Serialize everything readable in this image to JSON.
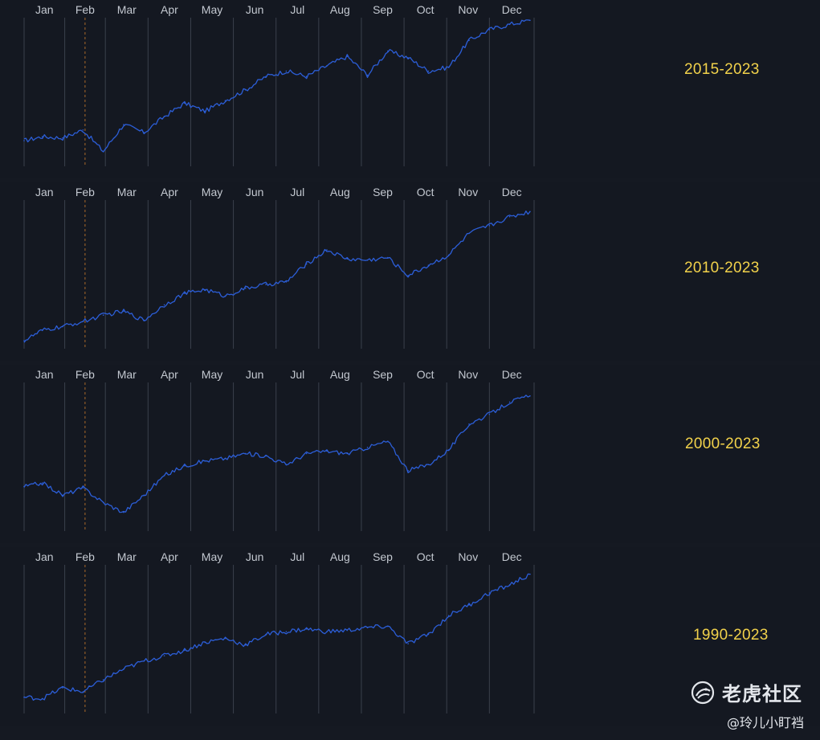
{
  "chart_data": [
    {
      "type": "line",
      "label": "2015-2023",
      "months": [
        "Jan",
        "Feb",
        "Mar",
        "Apr",
        "May",
        "Jun",
        "Jul",
        "Aug",
        "Sep",
        "Oct",
        "Nov",
        "Dec"
      ],
      "marker_month": "Feb",
      "x": [
        1,
        10,
        20,
        30,
        40,
        50,
        60,
        70,
        80,
        90,
        100,
        110,
        120,
        130,
        140,
        150,
        160,
        170,
        180,
        190,
        200,
        210,
        220,
        230,
        240,
        250
      ],
      "values": [
        1.8,
        2.1,
        2.0,
        2.6,
        1.0,
        3.0,
        2.4,
        3.6,
        4.6,
        4.0,
        4.8,
        5.6,
        6.6,
        7.0,
        6.6,
        7.4,
        8.1,
        6.7,
        8.5,
        8.0,
        7.0,
        7.3,
        9.3,
        10.1,
        10.5,
        10.8
      ],
      "ylim": [
        0,
        11
      ],
      "color": "#2c5ed8"
    },
    {
      "type": "line",
      "label": "2010-2023",
      "months": [
        "Jan",
        "Feb",
        "Mar",
        "Apr",
        "May",
        "Jun",
        "Jul",
        "Aug",
        "Sep",
        "Oct",
        "Nov",
        "Dec"
      ],
      "marker_month": "Feb",
      "x": [
        1,
        10,
        20,
        30,
        40,
        50,
        60,
        70,
        80,
        90,
        100,
        110,
        120,
        130,
        140,
        150,
        160,
        170,
        180,
        190,
        200,
        210,
        220,
        230,
        240,
        250
      ],
      "values": [
        0.5,
        1.3,
        1.6,
        2.0,
        2.5,
        2.8,
        2.1,
        3.3,
        4.2,
        4.5,
        4.0,
        4.6,
        4.9,
        5.1,
        6.5,
        7.6,
        6.9,
        6.8,
        7.0,
        5.6,
        6.4,
        7.2,
        8.9,
        9.5,
        10.2,
        10.6
      ],
      "ylim": [
        0,
        11.5
      ],
      "color": "#2c5ed8"
    },
    {
      "type": "line",
      "label": "2000-2023",
      "months": [
        "Jan",
        "Feb",
        "Mar",
        "Apr",
        "May",
        "Jun",
        "Jul",
        "Aug",
        "Sep",
        "Oct",
        "Nov",
        "Dec"
      ],
      "marker_month": "Feb",
      "x": [
        1,
        10,
        20,
        30,
        40,
        50,
        60,
        70,
        80,
        90,
        100,
        110,
        120,
        130,
        140,
        150,
        160,
        170,
        180,
        190,
        200,
        210,
        220,
        230,
        240,
        250
      ],
      "values": [
        3.5,
        3.8,
        2.8,
        3.4,
        2.2,
        1.4,
        2.8,
        4.4,
        5.2,
        5.6,
        5.8,
        6.2,
        6.0,
        5.3,
        6.2,
        6.4,
        6.2,
        6.7,
        7.2,
        4.8,
        5.3,
        6.5,
        8.6,
        9.4,
        10.4,
        10.9
      ],
      "ylim": [
        0,
        12
      ],
      "color": "#2c5ed8"
    },
    {
      "type": "line",
      "label": "1990-2023",
      "months": [
        "Jan",
        "Feb",
        "Mar",
        "Apr",
        "May",
        "Jun",
        "Jul",
        "Aug",
        "Sep",
        "Oct",
        "Nov",
        "Dec"
      ],
      "marker_month": "Feb",
      "x": [
        1,
        10,
        20,
        30,
        40,
        50,
        60,
        70,
        80,
        90,
        100,
        110,
        120,
        130,
        140,
        150,
        160,
        170,
        180,
        190,
        200,
        210,
        220,
        230,
        240,
        250
      ],
      "values": [
        1.1,
        1.0,
        1.8,
        1.5,
        2.4,
        3.2,
        3.8,
        4.2,
        4.6,
        5.2,
        5.5,
        5.0,
        5.8,
        6.0,
        6.2,
        6.0,
        6.1,
        6.3,
        6.4,
        5.1,
        5.8,
        7.2,
        8.0,
        8.9,
        9.5,
        10.3
      ],
      "ylim": [
        0,
        11
      ],
      "color": "#2c5ed8"
    }
  ],
  "watermark": {
    "brand": "老虎社区",
    "user": "@玲儿小盯裆"
  }
}
